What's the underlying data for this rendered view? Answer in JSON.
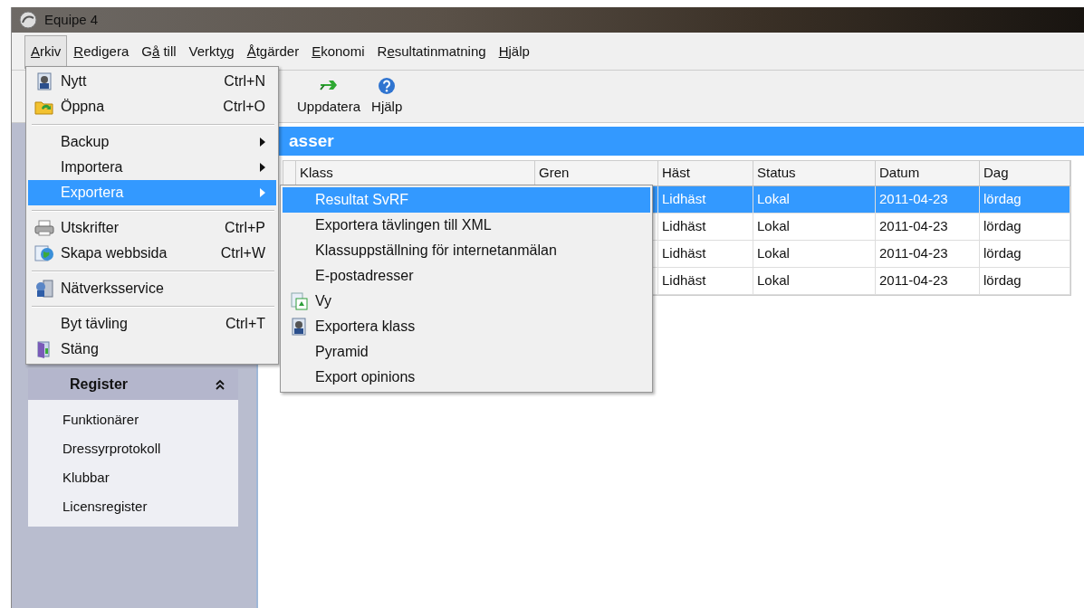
{
  "window": {
    "title": "Equipe 4"
  },
  "menu_bar": [
    {
      "key": "A",
      "after": "rkiv",
      "selected": true
    },
    {
      "key": "R",
      "after": "edigera",
      "selected": false
    },
    {
      "before": "G",
      "key": "å",
      "after": " till",
      "selected": false
    },
    {
      "before": "Verkt",
      "key": "y",
      "after": "g",
      "selected": false
    },
    {
      "key": "Å",
      "after": "tgärder",
      "selected": false
    },
    {
      "key": "E",
      "after": "konomi",
      "selected": false
    },
    {
      "before": "R",
      "key": "e",
      "after": "sultatinmatning",
      "selected": false
    },
    {
      "key": "H",
      "after": "jälp",
      "selected": false
    }
  ],
  "toolbar": [
    {
      "label": "Uppdatera"
    },
    {
      "label": "Hjälp"
    }
  ],
  "arkiv_menu": [
    {
      "kind": "item",
      "label": "Nytt",
      "shortcut": "Ctrl+N",
      "submenu": false,
      "selected": false
    },
    {
      "kind": "item",
      "label": "Öppna",
      "shortcut": "Ctrl+O",
      "submenu": false,
      "selected": false
    },
    {
      "kind": "separator"
    },
    {
      "kind": "item",
      "label": "Backup",
      "submenu": true,
      "selected": false
    },
    {
      "kind": "item",
      "label": "Importera",
      "submenu": true,
      "selected": false
    },
    {
      "kind": "item",
      "label": "Exportera",
      "submenu": true,
      "selected": true
    },
    {
      "kind": "separator"
    },
    {
      "kind": "item",
      "label": "Utskrifter",
      "shortcut": "Ctrl+P",
      "submenu": false,
      "selected": false
    },
    {
      "kind": "item",
      "label": "Skapa webbsida",
      "shortcut": "Ctrl+W",
      "submenu": false,
      "selected": false
    },
    {
      "kind": "separator"
    },
    {
      "kind": "item",
      "label": "Nätverksservice",
      "submenu": false,
      "selected": false
    },
    {
      "kind": "separator"
    },
    {
      "kind": "item",
      "label": "Byt tävling",
      "shortcut": "Ctrl+T",
      "submenu": false,
      "selected": false
    },
    {
      "kind": "item",
      "label": "Stäng",
      "submenu": false,
      "selected": false
    }
  ],
  "export_submenu": [
    {
      "label": "Resultat SvRF",
      "selected": true
    },
    {
      "label": "Exportera tävlingen till XML",
      "selected": false
    },
    {
      "label": "Klassuppställning för internetanmälan",
      "selected": false
    },
    {
      "label": "E-postadresser",
      "selected": false
    },
    {
      "label": "Vy",
      "selected": false
    },
    {
      "label": "Exportera klass",
      "selected": false
    },
    {
      "label": "Pyramid",
      "selected": false
    },
    {
      "label": "Export opinions",
      "selected": false
    }
  ],
  "sidebar": {
    "panel": {
      "title": "Register",
      "expanded": true,
      "items": [
        "Funktionärer",
        "Dressyrprotokoll",
        "Klubbar",
        "Licensregister"
      ]
    }
  },
  "main": {
    "header": "asser",
    "table": {
      "columns": [
        "",
        "Klass",
        "Gren",
        "Häst",
        "Status",
        "Datum",
        "Dag"
      ],
      "rows": [
        {
          "cells": [
            "",
            "",
            "",
            "Lidhäst",
            "Lokal",
            "2011-04-23",
            "lördag"
          ],
          "selected": true
        },
        {
          "cells": [
            "",
            "",
            "",
            "Lidhäst",
            "Lokal",
            "2011-04-23",
            "lördag"
          ],
          "selected": false
        },
        {
          "cells": [
            "",
            "",
            "",
            "Lidhäst",
            "Lokal",
            "2011-04-23",
            "lördag"
          ],
          "selected": false
        },
        {
          "cells": [
            "",
            "",
            "",
            "Lidhäst",
            "Lokal",
            "2011-04-23",
            "lördag"
          ],
          "selected": false
        }
      ]
    }
  }
}
